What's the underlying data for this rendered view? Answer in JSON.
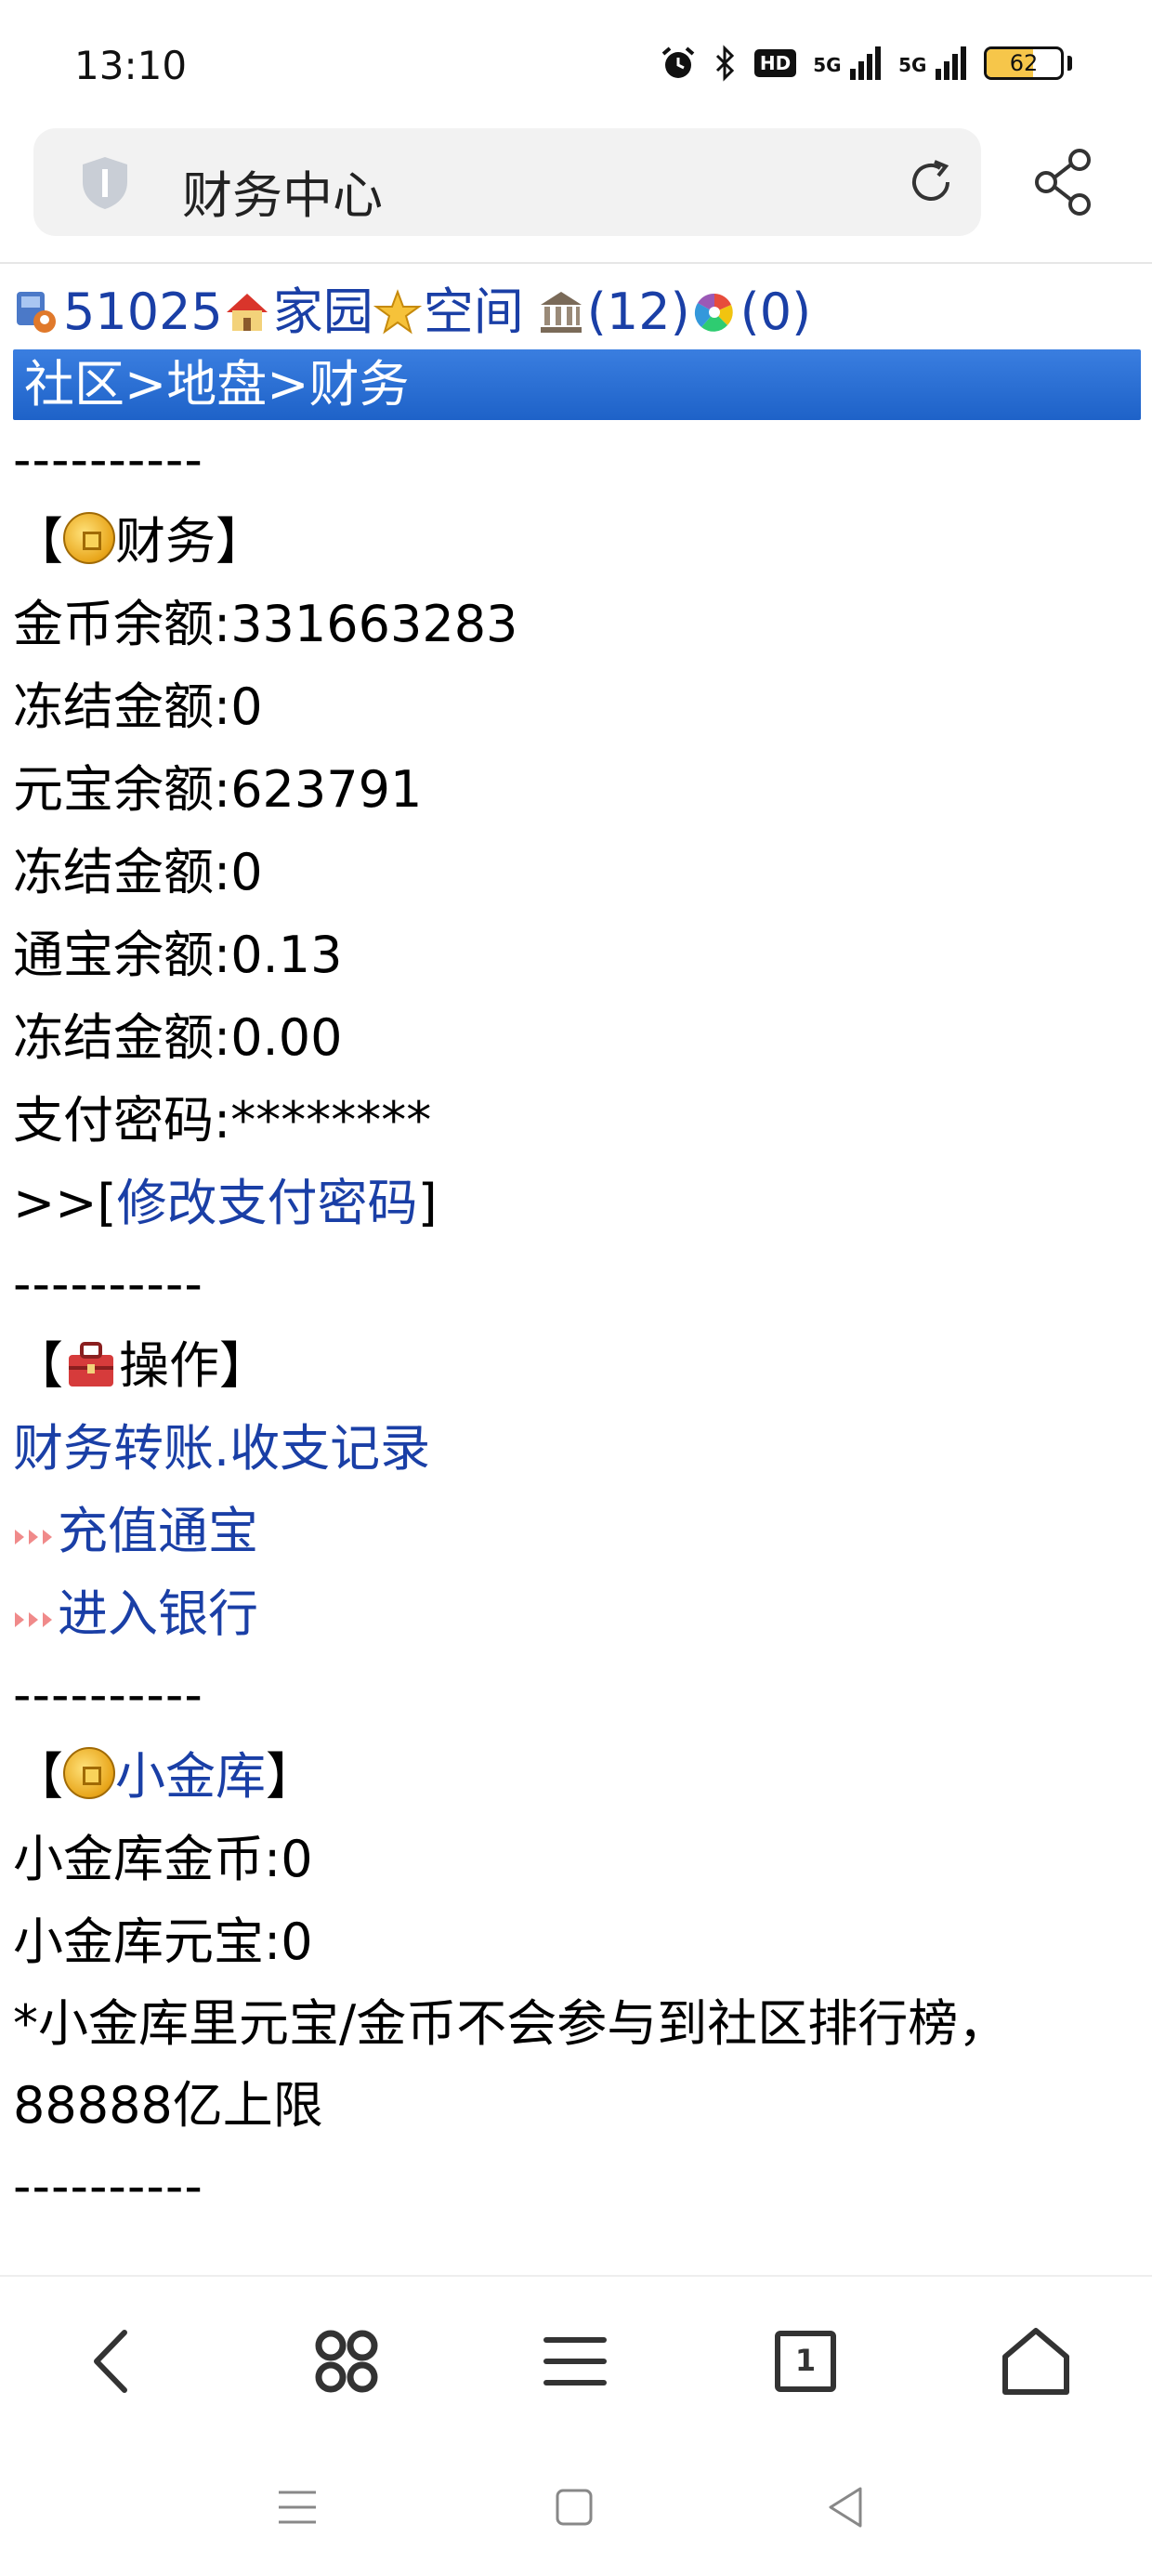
{
  "status_bar": {
    "time": "13:10",
    "hd_label": "HD",
    "network1": "5G",
    "network2": "5G",
    "battery_level": "62",
    "battery_fraction": 0.62,
    "icons": [
      "alarm-icon",
      "bluetooth-icon",
      "signal-icon",
      "signal-icon",
      "battery-icon"
    ]
  },
  "address_bar": {
    "title": "财务中心",
    "icons": [
      "shield-icon",
      "reload-icon",
      "share-icon"
    ]
  },
  "toplinks": {
    "user_id": "51025",
    "home": "家园",
    "space": "空间",
    "bank_count": "(12)",
    "msg_count": "(0)"
  },
  "breadcrumb": {
    "community": "社区",
    "sep1": ">",
    "area": "地盘",
    "sep2": ">",
    "finance": "财务"
  },
  "divider": "----------",
  "finance": {
    "heading_open": "【",
    "heading": "财务",
    "heading_close": "】",
    "gold_balance_label": "金币余额:",
    "gold_balance": "331663283",
    "frozen1_label": "冻结金额:",
    "frozen1": "0",
    "yuanbao_balance_label": "元宝余额:",
    "yuanbao_balance": "623791",
    "frozen2_label": "冻结金额:",
    "frozen2": "0",
    "tongbao_balance_label": "通宝余额:",
    "tongbao_balance": "0.13",
    "frozen3_label": "冻结金额:",
    "frozen3": "0.00",
    "pay_password_label": "支付密码:",
    "pay_password": "********",
    "modify_prefix": ">>[",
    "modify_link": "修改支付密码",
    "modify_suffix": "]"
  },
  "operations": {
    "heading_open": "【",
    "heading": "操作",
    "heading_close": "】",
    "transfer_link": "财务转账.收支记录",
    "recharge_link": "充值通宝",
    "bank_link": "进入银行"
  },
  "vault": {
    "heading_open": "【",
    "heading_link": "小金库",
    "heading_close": "】",
    "gold_label": "小金库金币:",
    "gold": "0",
    "yuanbao_label": "小金库元宝:",
    "yuanbao": "0",
    "note_line1": "*小金库里元宝/金币不会参与到社区排行榜，",
    "note_line2": "88888亿上限"
  },
  "bottom_nav": {
    "icons": [
      "back-icon",
      "apps-icon",
      "menu-icon",
      "tabs-icon",
      "home-icon"
    ],
    "tab_count": "1"
  },
  "system_nav": {
    "icons": [
      "recent-apps-icon",
      "home-square-icon",
      "back-triangle-icon"
    ]
  }
}
